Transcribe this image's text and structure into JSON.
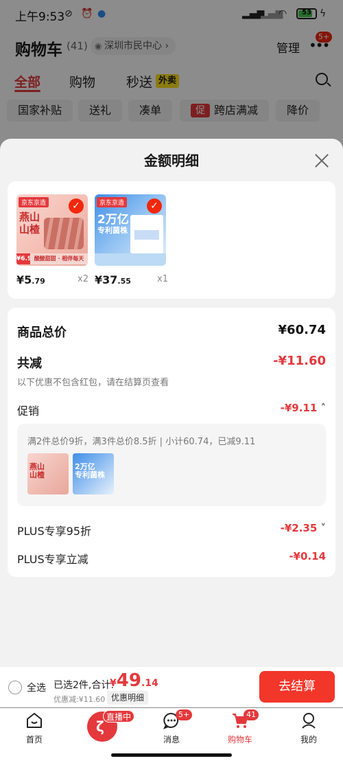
{
  "status_bar": {
    "time": "上午9:53",
    "battery": "53"
  },
  "cart_header": {
    "title": "购物车",
    "count": "(41)",
    "location": "深圳市民中心",
    "manage": "管理",
    "more_badge": "5+",
    "tabs": [
      "全部",
      "购物",
      "秒送"
    ],
    "flash_badge": "外卖",
    "chips": [
      "国家补贴",
      "送礼",
      "凑单",
      "跨店满减",
      "降价"
    ],
    "promo_tag": "促"
  },
  "sheet": {
    "title": "金额明细",
    "items": [
      {
        "price_int": "¥5",
        "price_dec": ".79",
        "qty": "x2",
        "tag_logo": "京东京造",
        "thumb_line1": "燕山",
        "thumb_line2": "山楂",
        "thumb_price": "¥6.9",
        "thumb_bar": "酸酸甜甜 · 相伴每天"
      },
      {
        "price_int": "¥37",
        "price_dec": ".55",
        "qty": "x1",
        "tag_logo": "京东京造",
        "thumb_line1": "2万亿",
        "thumb_line2": "专利菌株"
      }
    ],
    "subtotal_label": "商品总价",
    "subtotal_value": "¥60.74",
    "discount_label": "共减",
    "discount_value": "-¥11.60",
    "discount_note": "以下优惠不包含红包，请在结算页查看",
    "promo_label": "促销",
    "promo_value": "-¥9.11",
    "promo_desc": "满2件总价9折，满3件总价8.5折 | 小计60.74，已减9.11",
    "mini_1": [
      "燕山",
      "山楂"
    ],
    "mini_2": [
      "2万亿",
      "专利菌株"
    ],
    "plus95_label": "PLUS专享95折",
    "plus95_value": "-¥2.35",
    "plusinst_label": "PLUS专享立减",
    "plusinst_value": "-¥0.14"
  },
  "checkout": {
    "select_all": "全选",
    "summary": "已选2件,合计:",
    "total_yen": "¥",
    "total_int": "49",
    "total_dec": ".14",
    "saved": "优惠减:¥11.60",
    "detail_chip": "优惠明细",
    "button": "去结算"
  },
  "bottom_nav": {
    "home": "首页",
    "live_badge": "直播中",
    "messages": "消息",
    "messages_badge": "5+",
    "cart": "购物车",
    "cart_badge": "41",
    "mine": "我的"
  },
  "colors": {
    "accent": "#e4393c",
    "checkout_button": "#f2362a",
    "flash_badge": "#ffe11b"
  }
}
